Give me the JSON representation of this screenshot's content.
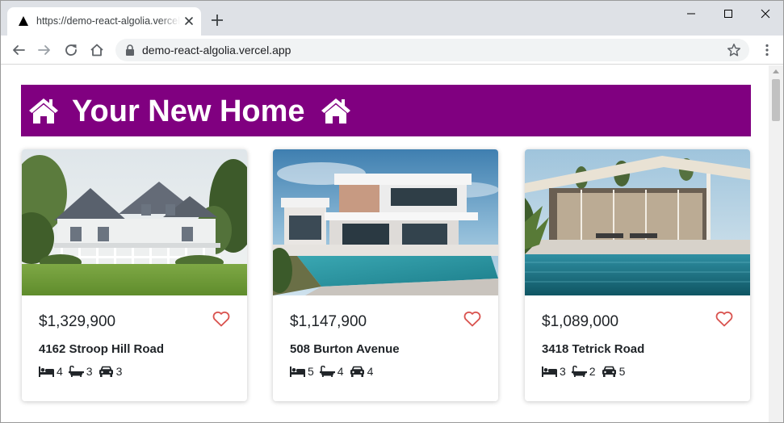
{
  "browser": {
    "tab_title": "https://demo-react-algolia.vercel.app",
    "url": "demo-react-algolia.vercel.app",
    "icons": [
      "tab-favicon-icon",
      "close-icon",
      "plus-icon",
      "minimize-icon",
      "maximize-icon",
      "window-close-icon",
      "back-arrow-icon",
      "forward-arrow-icon",
      "reload-icon",
      "home-icon",
      "lock-icon",
      "star-icon",
      "kebab-menu-icon"
    ]
  },
  "page": {
    "title": "Your New Home",
    "banner_color": "#800080",
    "title_icon": "house-icon",
    "heart_color": "#d9534f"
  },
  "listings": [
    {
      "price": "$1,329,900",
      "address": "4162 Stroop Hill Road",
      "beds": "4",
      "baths": "3",
      "garage": "3"
    },
    {
      "price": "$1,147,900",
      "address": "508 Burton Avenue",
      "beds": "5",
      "baths": "4",
      "garage": "4"
    },
    {
      "price": "$1,089,000",
      "address": "3418 Tetrick Road",
      "beds": "3",
      "baths": "2",
      "garage": "5"
    }
  ],
  "feature_icons": [
    "bed-icon",
    "bath-icon",
    "car-icon"
  ]
}
